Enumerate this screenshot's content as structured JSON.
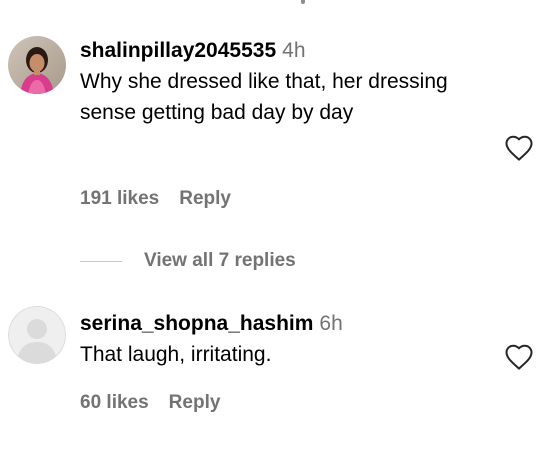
{
  "comments": [
    {
      "username": "shalinpillay2045535",
      "time": "4h",
      "text": "Why she dressed like that, her dressing sense getting bad day by day",
      "likes": "191 likes",
      "reply_label": "Reply",
      "avatar": "profile-photo",
      "like_icon": "heart-outline-icon"
    },
    {
      "username": "serina_shopna_hashim",
      "time": "6h",
      "text": "That laugh, irritating.",
      "likes": "60 likes",
      "reply_label": "Reply",
      "avatar": "default-avatar-placeholder",
      "like_icon": "heart-outline-icon"
    }
  ],
  "view_replies_label": "View all 7 replies",
  "colors": {
    "text": "#000000",
    "secondary": "#737373",
    "divider": "#c7c7c7",
    "placeholder_avatar": "#dbdbdb"
  }
}
